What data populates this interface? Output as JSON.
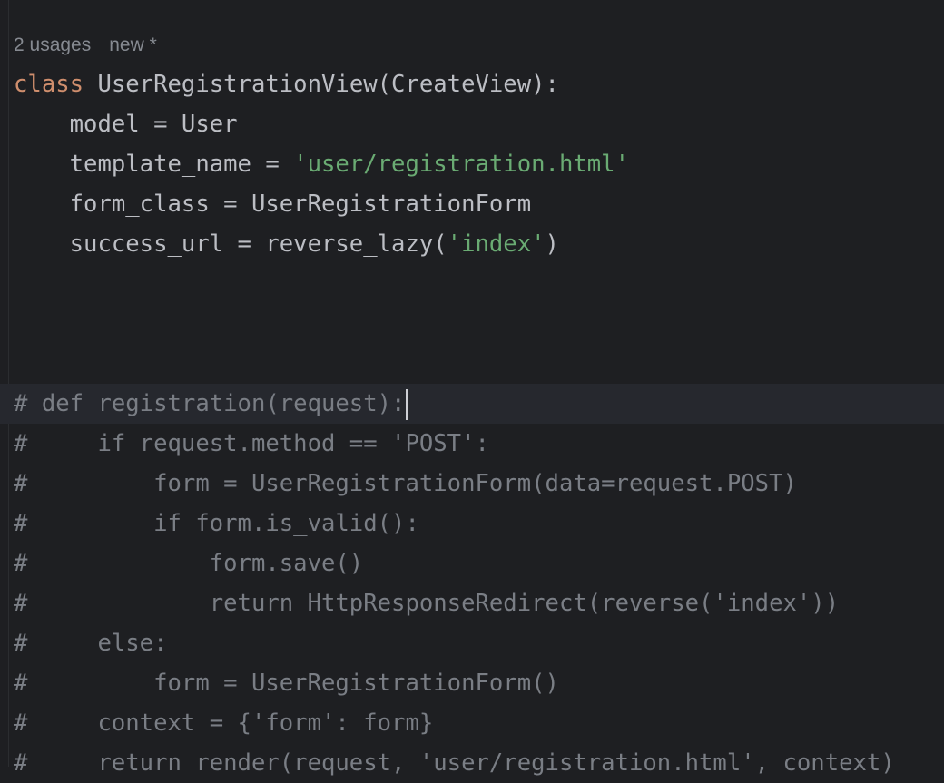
{
  "inlay": {
    "usages": "2 usages",
    "author": "new *"
  },
  "colors": {
    "background": "#1e1f22",
    "keyword": "#cf8e6d",
    "string": "#6aab73",
    "comment": "#7a7e85",
    "text": "#bcbec4"
  },
  "current_line_index": 8,
  "lines": [
    [
      {
        "t": "class",
        "c": "kw"
      },
      {
        "t": " UserRegistrationView(CreateView):",
        "c": "plain"
      }
    ],
    [
      {
        "t": "    model = User",
        "c": "plain"
      }
    ],
    [
      {
        "t": "    template_name = ",
        "c": "plain"
      },
      {
        "t": "'user/registration.html'",
        "c": "str"
      }
    ],
    [
      {
        "t": "    form_class = UserRegistrationForm",
        "c": "plain"
      }
    ],
    [
      {
        "t": "    success_url = reverse_lazy(",
        "c": "plain"
      },
      {
        "t": "'index'",
        "c": "str"
      },
      {
        "t": ")",
        "c": "plain"
      }
    ],
    [],
    [],
    [],
    [
      {
        "t": "# def registration(request):",
        "c": "cm"
      }
    ],
    [
      {
        "t": "#     if request.method == 'POST':",
        "c": "cm"
      }
    ],
    [
      {
        "t": "#         form = UserRegistrationForm(data=request.POST)",
        "c": "cm"
      }
    ],
    [
      {
        "t": "#         if form.is_valid():",
        "c": "cm"
      }
    ],
    [
      {
        "t": "#             form.save()",
        "c": "cm"
      }
    ],
    [
      {
        "t": "#             return HttpResponseRedirect(reverse('index'))",
        "c": "cm"
      }
    ],
    [
      {
        "t": "#     else:",
        "c": "cm"
      }
    ],
    [
      {
        "t": "#         form = UserRegistrationForm()",
        "c": "cm"
      }
    ],
    [
      {
        "t": "#     context = {'form': form}",
        "c": "cm"
      }
    ],
    [
      {
        "t": "#     return render(request, 'user/registration.html', context)",
        "c": "cm"
      }
    ]
  ]
}
